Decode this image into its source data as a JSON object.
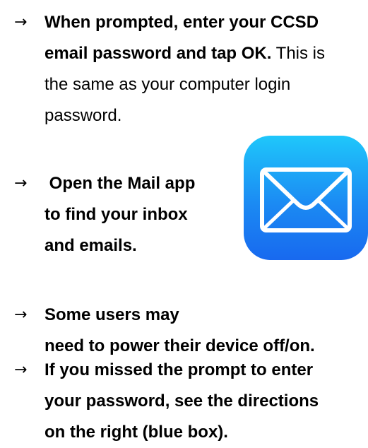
{
  "items": [
    {
      "arrow": "→",
      "lines": [
        {
          "bold": "When prompted, enter your CCSD",
          "normal": ""
        },
        {
          "bold": "email password and tap OK.",
          "normal": " This is"
        },
        {
          "bold": "",
          "normal": "the same as your computer login"
        },
        {
          "bold": "",
          "normal": "password."
        }
      ]
    },
    {
      "arrow": "→",
      "lines": [
        {
          "bold": " Open the Mail app",
          "normal": ""
        },
        {
          "bold": "to find your inbox",
          "normal": ""
        },
        {
          "bold": "and emails.",
          "normal": ""
        }
      ]
    },
    {
      "arrow": "→",
      "lines": [
        {
          "bold": "Some users may",
          "normal": ""
        },
        {
          "bold": "need to power their device off/on.",
          "normal": ""
        }
      ]
    },
    {
      "arrow": "→",
      "lines": [
        {
          "bold": "If you missed the prompt to enter",
          "normal": ""
        },
        {
          "bold": "your password, see the directions",
          "normal": ""
        },
        {
          "bold": "on the right (blue box).",
          "normal": ""
        }
      ]
    }
  ],
  "mail_icon": {
    "icon": "mail-envelope-icon",
    "gradient_top": "#1fc7fb",
    "gradient_bottom": "#1869ef",
    "envelope_color": "#ffffff"
  }
}
